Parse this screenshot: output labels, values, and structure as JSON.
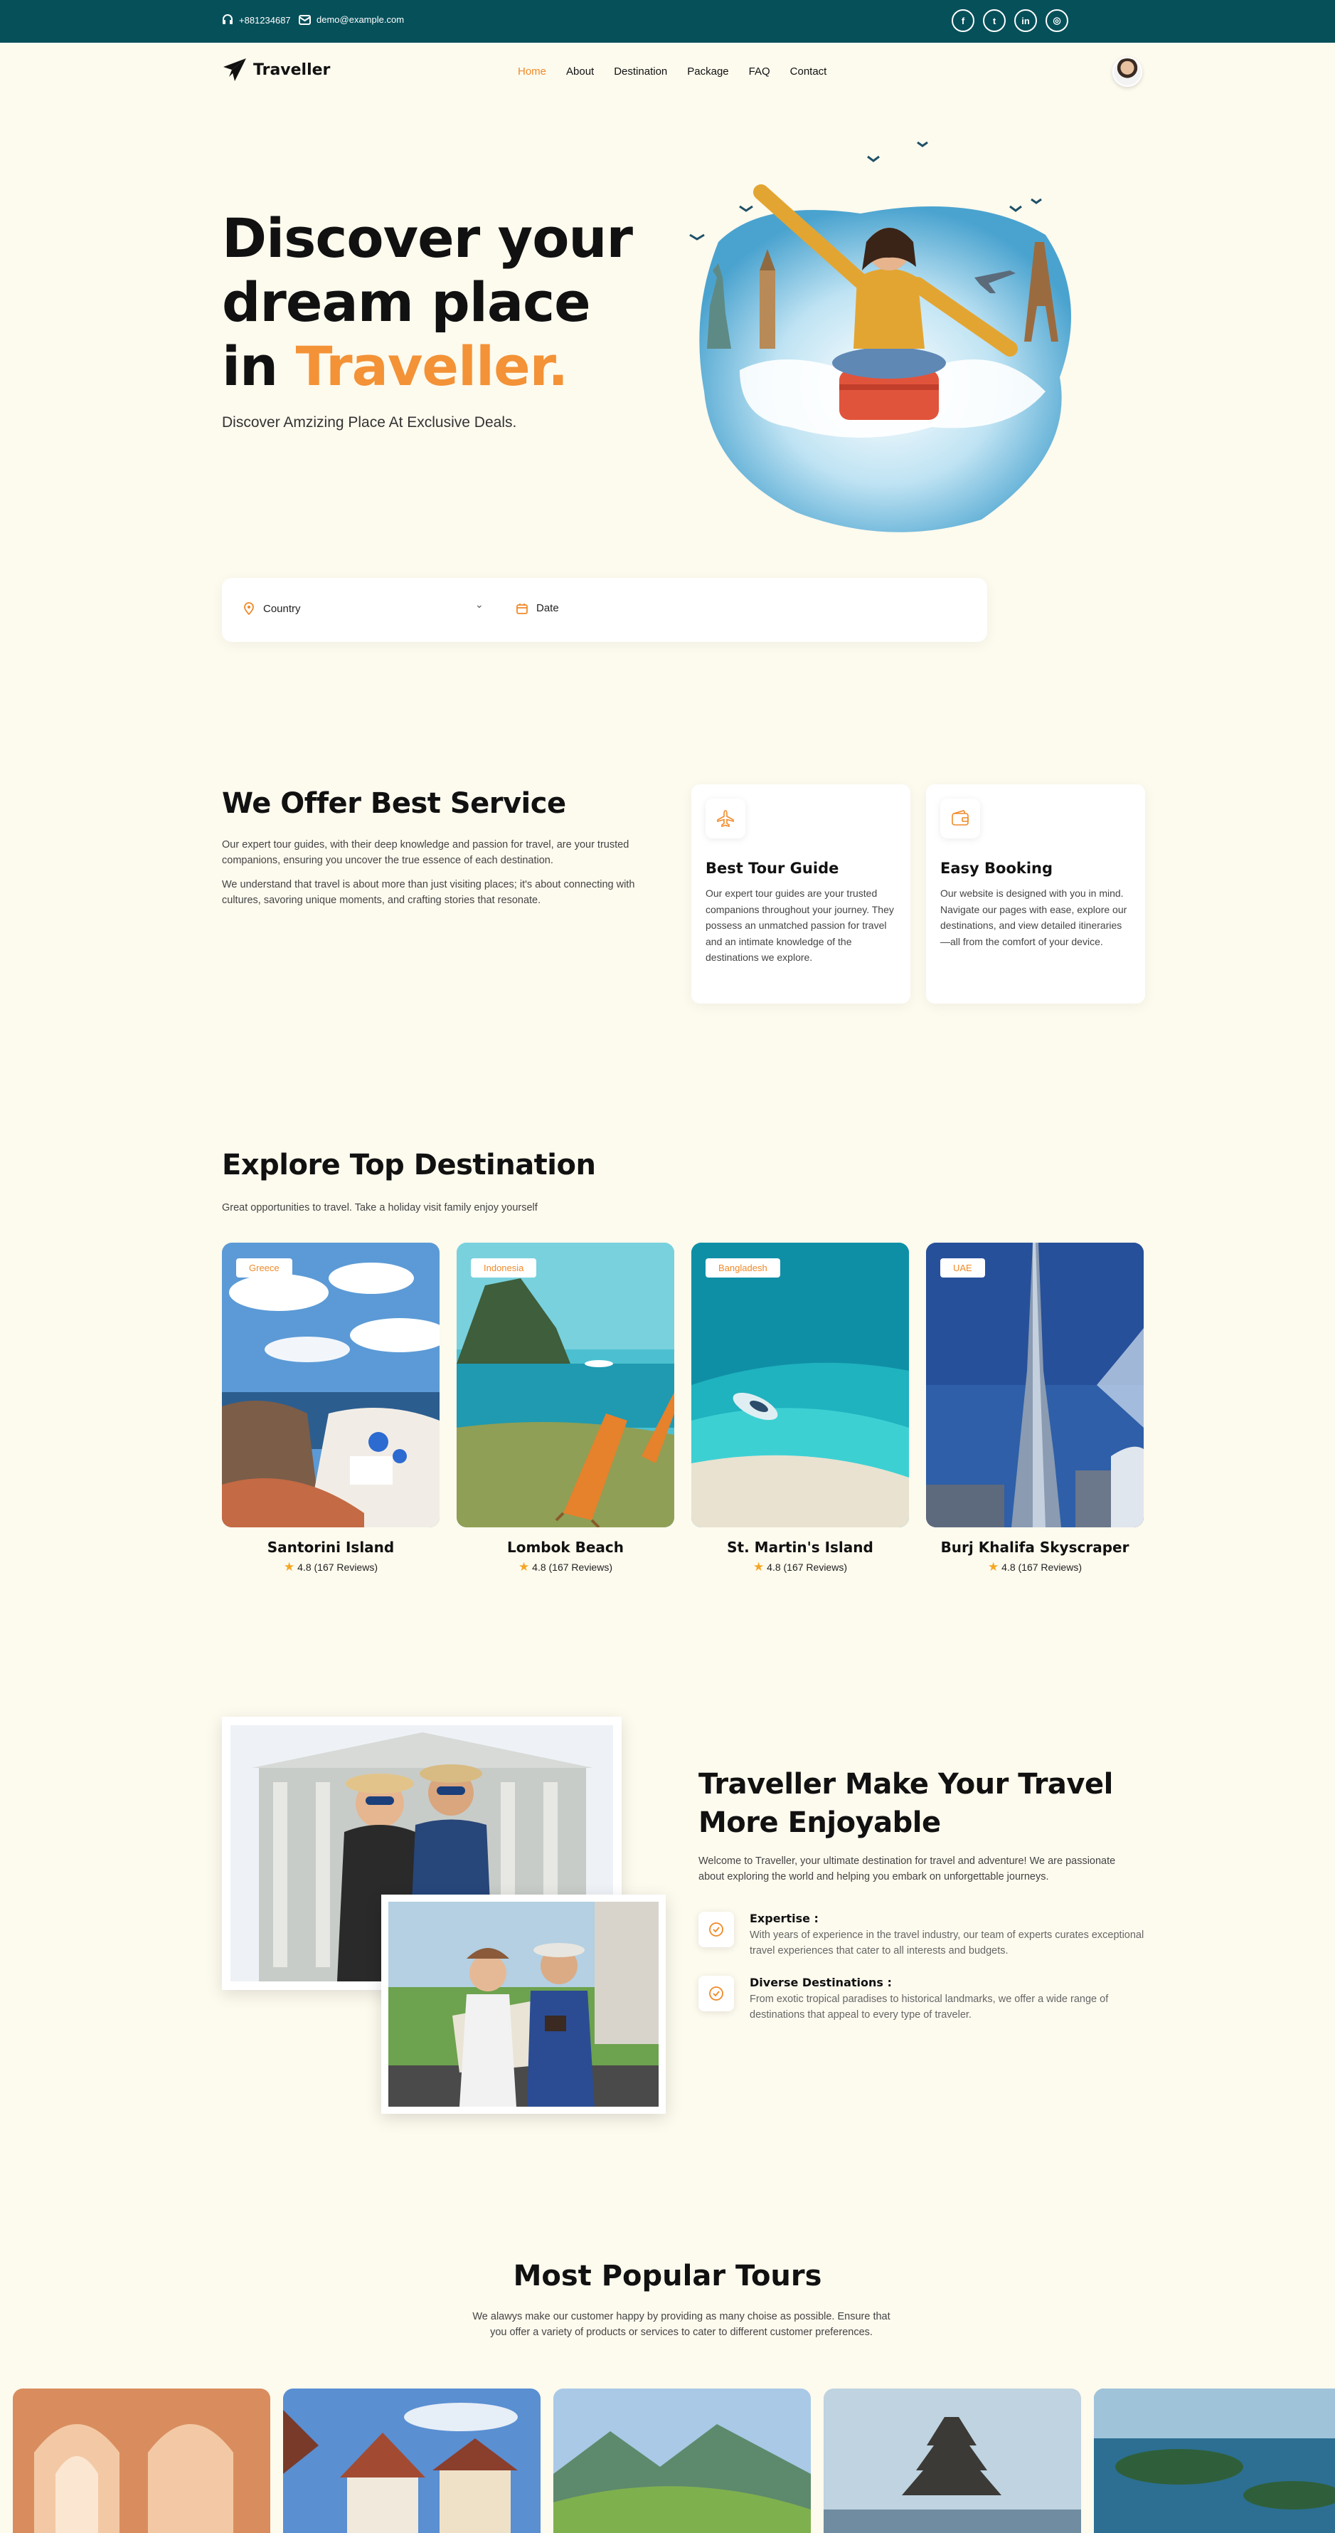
{
  "topbar": {
    "phone": "+881234687",
    "email": "demo@example.com",
    "socials": [
      "facebook-icon",
      "twitter-icon",
      "linkedin-icon",
      "instagram-icon"
    ],
    "social_glyphs": [
      "f",
      "t",
      "in",
      "◎"
    ]
  },
  "nav": {
    "brand": "Traveller",
    "items": [
      "Home",
      "About",
      "Destination",
      "Package",
      "FAQ",
      "Contact"
    ],
    "active": "Home"
  },
  "hero": {
    "title_line1": "Discover your",
    "title_line2": "dream place",
    "title_line3_prefix": "in ",
    "title_line3_accent": "Traveller.",
    "subtitle": "Discover Amzizing Place At Exclusive Deals."
  },
  "search": {
    "country_label": "Country",
    "date_label": "Date"
  },
  "services": {
    "title": "We Offer Best Service",
    "para1": "Our expert tour guides, with their deep knowledge and passion for travel, are your trusted companions, ensuring you uncover the true essence of each destination.",
    "para2": "We understand that travel is about more than just visiting places; it's about connecting with cultures, savoring unique moments, and crafting stories that resonate.",
    "cards": [
      {
        "title": "Best Tour Guide",
        "text": "Our expert tour guides are your trusted companions throughout your journey. They possess an unmatched passion for travel and an intimate knowledge of the destinations we explore."
      },
      {
        "title": "Easy Booking",
        "text": "Our website is designed with you in mind. Navigate our pages with ease, explore our destinations, and view detailed itineraries—all from the comfort of your device."
      }
    ]
  },
  "destinations": {
    "title": "Explore Top Destination",
    "subtitle": "Great opportunities to travel. Take a holiday visit family enjoy yourself",
    "items": [
      {
        "tag": "Greece",
        "name": "Santorini Island",
        "rating": "4.8 (167 Reviews)"
      },
      {
        "tag": "Indonesia",
        "name": "Lombok Beach",
        "rating": "4.8 (167 Reviews)"
      },
      {
        "tag": "Bangladesh",
        "name": "St. Martin's Island",
        "rating": "4.8 (167 Reviews)"
      },
      {
        "tag": "UAE",
        "name": "Burj Khalifa Skyscraper",
        "rating": "4.8 (167 Reviews)"
      }
    ]
  },
  "enjoyable": {
    "title_line1": "Traveller Make Your Travel",
    "title_line2": "More Enjoyable",
    "intro": "Welcome to Traveller, your ultimate destination for travel and adventure! We are passionate about exploring the world and helping you embark on unforgettable journeys.",
    "features": [
      {
        "title": "Expertise :",
        "text": "With years of experience in the travel industry, our team of experts curates exceptional travel experiences that cater to all interests and budgets."
      },
      {
        "title": "Diverse Destinations :",
        "text": "From exotic tropical paradises to historical landmarks, we offer a wide range of destinations that appeal to every type of traveler."
      }
    ]
  },
  "popular": {
    "title": "Most Popular Tours",
    "subtitle": "We alawys make our customer happy by providing as many choise as possible. Ensure that you offer a variety of products or services to cater to different customer preferences."
  },
  "colors": {
    "topbar": "#06505a",
    "accent": "#f39236",
    "page_bg": "#fdfaee"
  }
}
